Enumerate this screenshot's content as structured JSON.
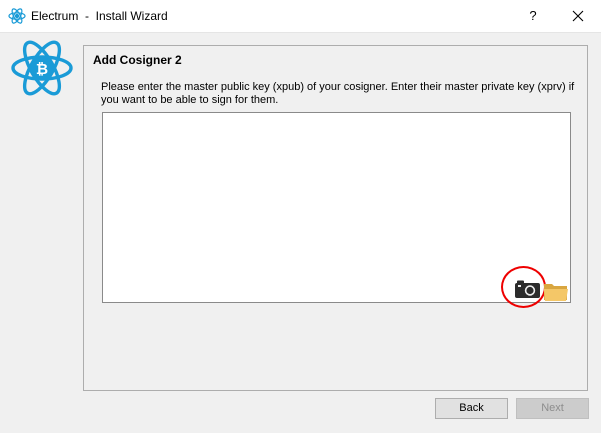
{
  "window": {
    "app_name": "Electrum",
    "title": "Electrum  -  Install Wizard",
    "help_label": "?",
    "close_icon": "close-icon",
    "app_icon": "electrum-atom-icon"
  },
  "wizard": {
    "logo_icon": "electrum-bitcoin-atom-logo",
    "title": "Add Cosigner 2",
    "description": "Please enter the master public key (xpub) of your cosigner. Enter their master private key (xprv) if you want to be able to sign for them.",
    "key_input_value": "",
    "camera_icon": "camera-icon",
    "folder_icon": "folder-icon",
    "annotation_color": "#e00000"
  },
  "buttons": {
    "back_label": "Back",
    "next_label": "Next",
    "next_enabled": false
  },
  "colors": {
    "accent": "#1a9bd7",
    "background": "#f0f0f0"
  }
}
